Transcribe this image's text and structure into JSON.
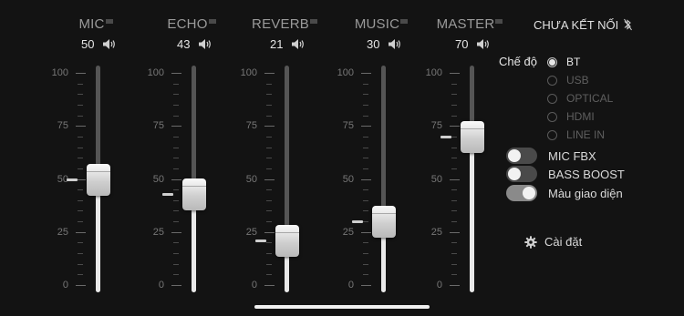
{
  "channels": [
    {
      "name": "MIC",
      "value": "50",
      "level": 50,
      "marker": 50
    },
    {
      "name": "ECHO",
      "value": "43",
      "level": 43,
      "marker": 43
    },
    {
      "name": "REVERB",
      "value": "21",
      "level": 21,
      "marker": 21
    },
    {
      "name": "MUSIC",
      "value": "30",
      "level": 30,
      "marker": 30
    },
    {
      "name": "MASTER",
      "value": "70",
      "level": 70,
      "marker": 70
    }
  ],
  "scale_labels": [
    "100",
    "75",
    "50",
    "25",
    "0"
  ],
  "status": {
    "bluetooth": "CHƯA KẾT NỐI"
  },
  "mode": {
    "label": "Chế độ",
    "options": [
      {
        "label": "BT",
        "selected": true
      },
      {
        "label": "USB",
        "selected": false
      },
      {
        "label": "OPTICAL",
        "selected": false
      },
      {
        "label": "HDMI",
        "selected": false
      },
      {
        "label": "LINE IN",
        "selected": false
      }
    ]
  },
  "toggles": [
    {
      "label": "MIC FBX",
      "on": false
    },
    {
      "label": "BASS BOOST",
      "on": false
    },
    {
      "label": "Màu giao diện",
      "on": true
    }
  ],
  "settings": {
    "label": "Cài đặt"
  },
  "colors": {
    "background": "#131313",
    "track": "#555555",
    "fill": "#e9e9e9",
    "toggle_off": "#4a4a4a",
    "toggle_on": "#8a8a8a"
  }
}
